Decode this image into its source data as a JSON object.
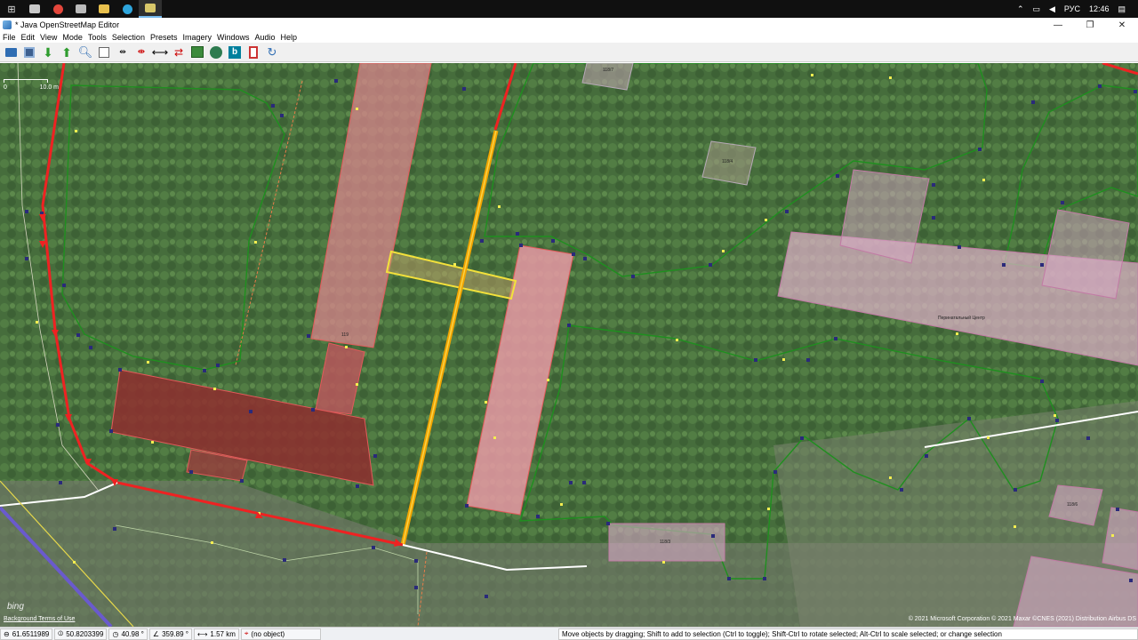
{
  "window": {
    "title": "* Java OpenStreetMap Editor",
    "minimize": "—",
    "maximize": "❐",
    "close": "✕"
  },
  "taskbar": {
    "start": "⊞",
    "language": "РУС",
    "time": "12:46"
  },
  "menu": {
    "file": "File",
    "edit": "Edit",
    "view": "View",
    "mode": "Mode",
    "tools": "Tools",
    "selection": "Selection",
    "presets": "Presets",
    "imagery": "Imagery",
    "windows": "Windows",
    "audio": "Audio",
    "help": "Help"
  },
  "toolbar_icons": [
    "open-icon",
    "save-icon",
    "download-icon",
    "upload-icon",
    "zoom-icon",
    "preferences-icon",
    "split-way-icon",
    "combine-way-icon",
    "reverse-way-icon",
    "unglue-icon",
    "imagery-icon",
    "layer-icon",
    "bing-icon",
    "bookmark-icon",
    "history-icon"
  ],
  "map": {
    "scale_left": "0",
    "scale_right": "10.0 m",
    "bing": "bing",
    "background_terms": "Background Terms of Use",
    "attribution": "© 2021 Microsoft Corporation © 2021 Maxar ©CNES (2021) Distribution Airbus DS",
    "labels": {
      "b1": "119",
      "b2": "Перинатальный Центр",
      "b3": "118/4",
      "b4": "118/3",
      "b5": "118/7",
      "b6": "118/6"
    }
  },
  "status": {
    "lat": "61.6511989",
    "lon": "50.8203399",
    "heading": "40.98 °",
    "angle": "359.89 °",
    "distance": "1.57 km",
    "object": "(no object)",
    "help": "Move objects by dragging; Shift to add to selection (Ctrl to toggle); Shift-Ctrl to rotate selected; Alt-Ctrl to scale selected; or change selection"
  }
}
